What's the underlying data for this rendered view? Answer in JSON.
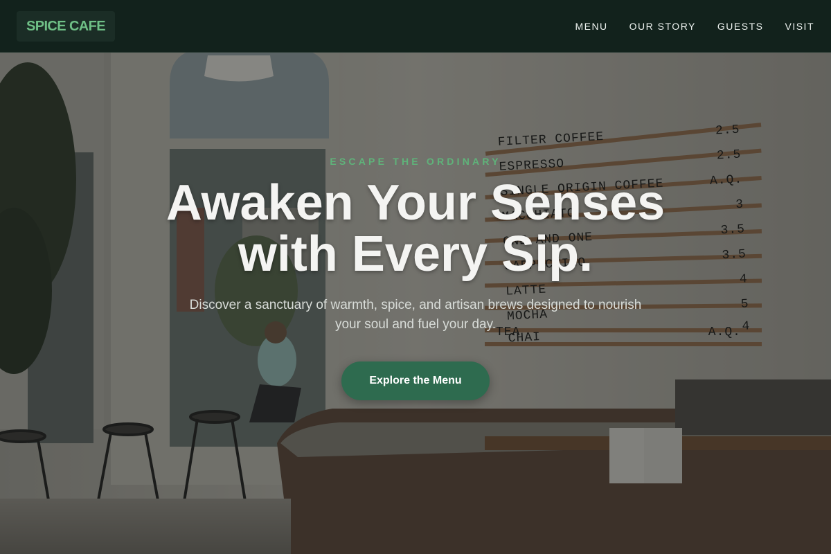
{
  "brand": {
    "logo_text": "SPICE CAFE"
  },
  "nav": {
    "items": [
      {
        "label": "MENU"
      },
      {
        "label": "OUR STORY"
      },
      {
        "label": "GUESTS"
      },
      {
        "label": "VISIT"
      }
    ]
  },
  "hero": {
    "eyebrow": "ESCAPE THE ORDINARY",
    "headline": "Awaken Your Senses with Every Sip.",
    "subtext": "Discover a sanctuary of warmth, spice, and artisan brews designed to nourish your soul and fuel your day.",
    "cta_label": "Explore the Menu",
    "background_image": "cafe-interior-photo"
  },
  "menu_board": {
    "items": [
      {
        "name": "FILTER COFFEE",
        "price": "2.5"
      },
      {
        "name": "ESPRESSO",
        "price": "2.5"
      },
      {
        "name": "SINGLE ORIGIN COFFEE",
        "price": "A.Q."
      },
      {
        "name": "MACCHIATO",
        "price": "3"
      },
      {
        "name": "ONE AND ONE",
        "price": "3.5"
      },
      {
        "name": "CAPPUCCINO",
        "price": "3.5"
      },
      {
        "name": "LATTE",
        "price": "4"
      },
      {
        "name": "MOCHA",
        "price": "5"
      },
      {
        "name": "CHAI",
        "price": "4"
      },
      {
        "name": "TEA",
        "price": "A.Q."
      }
    ]
  },
  "colors": {
    "header_bg": "#12221c",
    "logo_text": "#6fbf86",
    "accent_green": "#5fb37a",
    "cta_bg": "#2e6b4f",
    "headline": "#f4f4f2"
  }
}
